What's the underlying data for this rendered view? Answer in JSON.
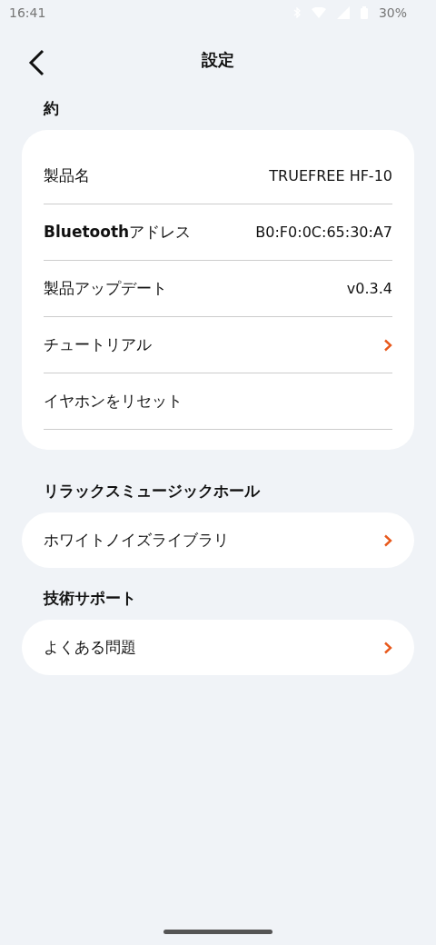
{
  "status_bar": {
    "time": "16:41",
    "battery": "30%"
  },
  "header": {
    "title": "設定"
  },
  "sections": [
    {
      "title": "約",
      "kind": "card",
      "rows": [
        {
          "kind": "value",
          "label": "製品名",
          "value": "TRUEFREE HF-10"
        },
        {
          "kind": "value",
          "label": "**Bluetooth**アドレス",
          "value": "B0:F0:0C:65:30:A7"
        },
        {
          "kind": "value",
          "label": "製品アップデート",
          "value": "v0.3.4"
        },
        {
          "kind": "link",
          "label": "チュートリアル"
        },
        {
          "kind": "plain",
          "label": "イヤホンをリセット"
        }
      ]
    },
    {
      "title": "リラックスミュージックホール",
      "kind": "pill",
      "rows": [
        {
          "kind": "link",
          "label": "ホワイトノイズライブラリ"
        }
      ]
    },
    {
      "title": "技術サポート",
      "kind": "pill",
      "rows": [
        {
          "kind": "link",
          "label": "よくある問題"
        }
      ]
    }
  ]
}
